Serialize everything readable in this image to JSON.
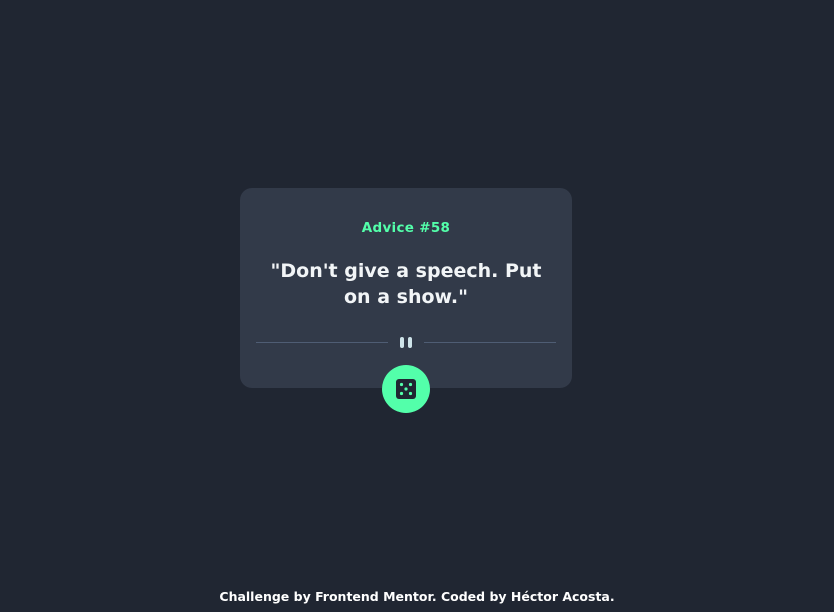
{
  "card": {
    "advice_label": "Advice #58",
    "quote": "\"Don't give a speech. Put on a show.\""
  },
  "icons": {
    "divider": "pause-icon",
    "button": "dice-icon"
  },
  "footer": {
    "credit": "Challenge by Frontend Mentor. Coded by Héctor Acosta."
  },
  "colors": {
    "background": "#202632",
    "card": "#323a49",
    "accent": "#53ffaa",
    "text": "#f2f5f7",
    "divider": "#4f5d74"
  }
}
